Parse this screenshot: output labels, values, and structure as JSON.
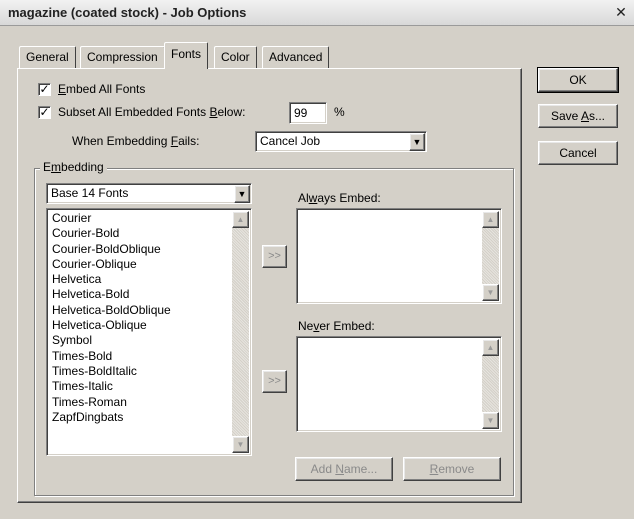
{
  "window": {
    "title": "magazine (coated stock) - Job Options",
    "close_glyph": "✕"
  },
  "tabs": [
    {
      "label": "General",
      "active": false
    },
    {
      "label": "Compression",
      "active": false
    },
    {
      "label": "Fonts",
      "active": true
    },
    {
      "label": "Color",
      "active": false
    },
    {
      "label": "Advanced",
      "active": false
    }
  ],
  "buttons": {
    "ok": "OK",
    "save_as_pre": "Save ",
    "save_as_key": "A",
    "save_as_post": "s...",
    "cancel": "Cancel"
  },
  "fonts": {
    "embed_all": {
      "pre": "",
      "key": "E",
      "post": "mbed All Fonts",
      "checked": true
    },
    "subset": {
      "pre": "Subset All Embedded Fonts ",
      "key": "B",
      "post": "elow:",
      "checked": true
    },
    "subset_value": "99",
    "subset_unit": "%",
    "when_fails": {
      "pre": "When Embedding ",
      "key": "F",
      "post": "ails:"
    },
    "when_fails_value": "Cancel Job",
    "check_glyph": "✓"
  },
  "embedding": {
    "group_pre": "E",
    "group_key": "m",
    "group_post": "bedding",
    "source_value": "Base 14 Fonts",
    "font_list": [
      "Courier",
      "Courier-Bold",
      "Courier-BoldOblique",
      "Courier-Oblique",
      "Helvetica",
      "Helvetica-Bold",
      "Helvetica-BoldOblique",
      "Helvetica-Oblique",
      "Symbol",
      "Times-Bold",
      "Times-BoldItalic",
      "Times-Italic",
      "Times-Roman",
      "ZapfDingbats"
    ],
    "always_label": {
      "pre": "Al",
      "key": "w",
      "post": "ays Embed:"
    },
    "never_label": {
      "pre": "Ne",
      "key": "v",
      "post": "er Embed:"
    },
    "move_glyph": ">>",
    "add_name": {
      "pre": "Add ",
      "key": "N",
      "post": "ame..."
    },
    "remove": {
      "pre": "",
      "key": "R",
      "post": "emove"
    }
  },
  "glyphs": {
    "down": "▼",
    "up": "▲"
  }
}
